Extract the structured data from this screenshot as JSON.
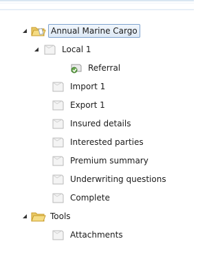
{
  "tree": {
    "root": {
      "label": "Annual Marine Cargo",
      "icon": "folder-open-icon"
    },
    "local": {
      "label": "Local 1",
      "icon": "page-icon"
    },
    "referral": {
      "label": "Referral",
      "icon": "referral-icon"
    },
    "import": {
      "label": "Import 1",
      "icon": "page-icon"
    },
    "export": {
      "label": "Export 1",
      "icon": "page-icon"
    },
    "insured": {
      "label": "Insured details",
      "icon": "page-icon"
    },
    "interested": {
      "label": "Interested parties",
      "icon": "page-icon"
    },
    "premium": {
      "label": "Premium summary",
      "icon": "page-icon"
    },
    "underwriting": {
      "label": "Underwriting questions",
      "icon": "page-icon"
    },
    "complete": {
      "label": "Complete",
      "icon": "page-icon"
    },
    "tools": {
      "label": "Tools",
      "icon": "folder-open-icon"
    },
    "attachments": {
      "label": "Attachments",
      "icon": "page-icon"
    }
  }
}
